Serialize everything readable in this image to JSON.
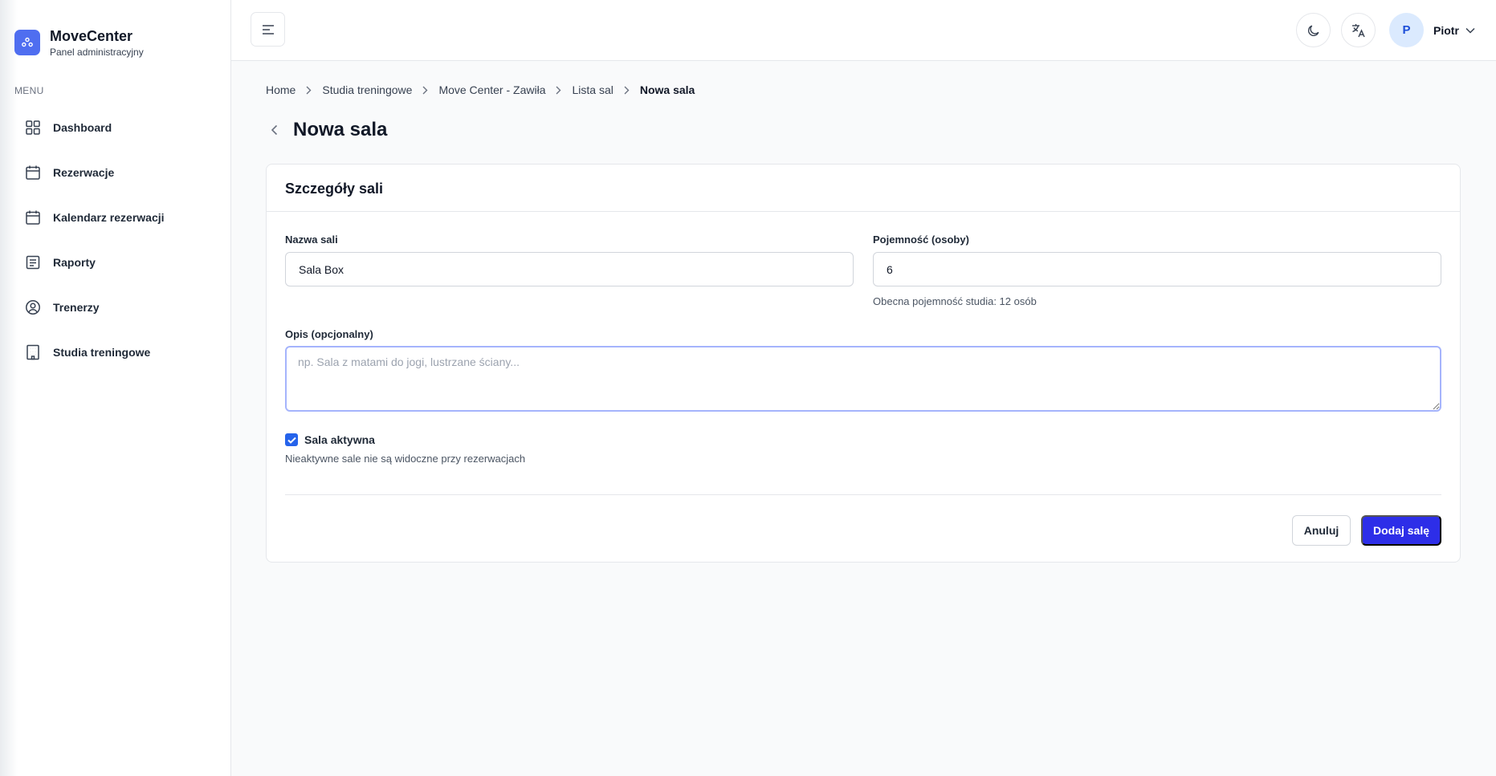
{
  "brand": {
    "title": "MoveCenter",
    "subtitle": "Panel administracyjny"
  },
  "sidebar": {
    "menu_label": "MENU",
    "items": [
      {
        "label": "Dashboard",
        "icon": "grid-icon"
      },
      {
        "label": "Rezerwacje",
        "icon": "calendar-icon"
      },
      {
        "label": "Kalendarz rezerwacji",
        "icon": "calendar-icon"
      },
      {
        "label": "Raporty",
        "icon": "report-icon"
      },
      {
        "label": "Trenerzy",
        "icon": "user-circle-icon"
      },
      {
        "label": "Studia treningowe",
        "icon": "building-icon"
      }
    ]
  },
  "header": {
    "user_initial": "P",
    "user_name": "Piotr"
  },
  "breadcrumb": [
    "Home",
    "Studia treningowe",
    "Move Center - Zawiła",
    "Lista sal",
    "Nowa sala"
  ],
  "page": {
    "title": "Nowa sala"
  },
  "form": {
    "card_title": "Szczegóły sali",
    "name_label": "Nazwa sali",
    "name_value": "Sala Box",
    "capacity_label": "Pojemność (osoby)",
    "capacity_value": "6",
    "capacity_hint": "Obecna pojemność studia: 12 osób",
    "description_label": "Opis (opcjonalny)",
    "description_placeholder": "np. Sala z matami do jogi, lustrzane ściany...",
    "description_value": "",
    "active_checked": true,
    "active_label": "Sala aktywna",
    "active_hint": "Nieaktywne sale nie są widoczne przy rezerwacjach",
    "cancel_label": "Anuluj",
    "submit_label": "Dodaj salę"
  },
  "colors": {
    "accent": "#2d2ee8",
    "brand_logo": "#4f6ef0",
    "checkbox": "#2563eb",
    "focus_ring": "#a5b4fc"
  }
}
